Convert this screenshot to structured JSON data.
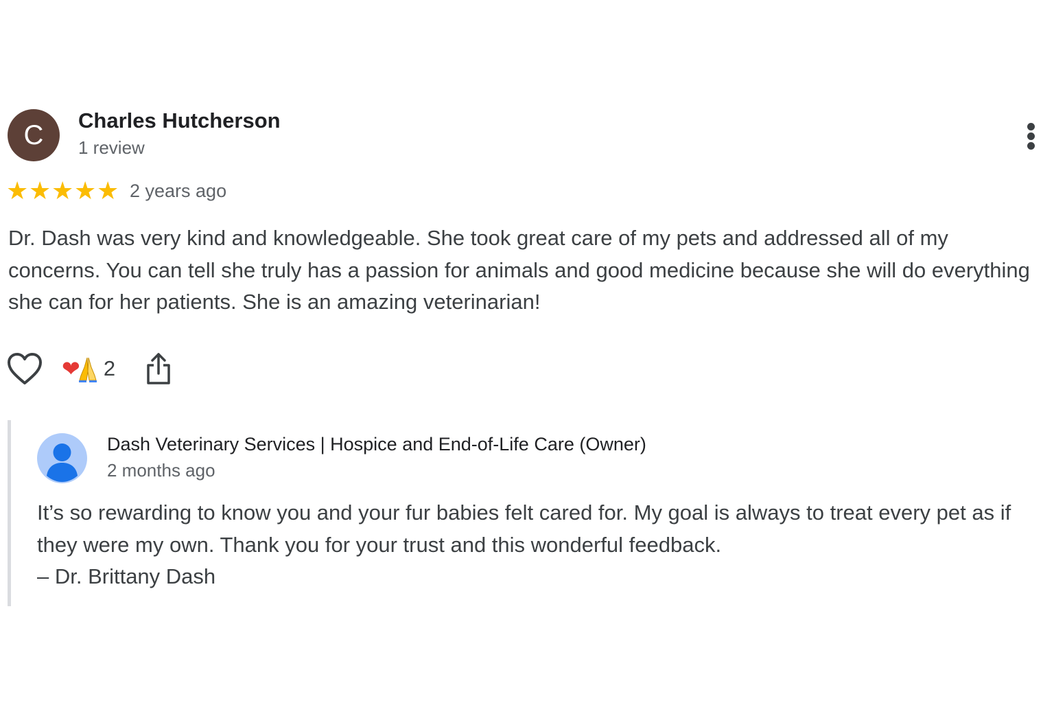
{
  "review": {
    "avatar_letter": "C",
    "avatar_color": "#5d4037",
    "reviewer_name": "Charles Hutcherson",
    "reviewer_review_count": "1 review",
    "rating": 5,
    "star_glyph": "★",
    "star_color": "#fbbc04",
    "time": "2 years ago",
    "text": "Dr. Dash was very kind and knowledgeable. She took great care of my pets and addressed all of my concerns. You can tell she truly has a passion for animals and good medicine because she will do everything she can for her patients. She is an amazing veterinarian!",
    "more_icon": "more-vert-icon"
  },
  "actions": {
    "like_icon": "heart-outline-icon",
    "reaction_icons": [
      "red-heart-emoji",
      "folded-hands-emoji"
    ],
    "reaction_heart_glyph": "❤",
    "reaction_count": "2",
    "share_icon": "share-icon"
  },
  "owner_response": {
    "owner_name": "Dash Veterinary Services | Hospice and End-of-Life Care (Owner)",
    "time": "2 months ago",
    "avatar_icon": "default-person-avatar-icon",
    "avatar_color": "#aecbfa",
    "text_lines": [
      "It’s so rewarding to know you and your fur babies felt cared for. My goal is always to treat every pet as if they were my own. Thank you for your trust and this wonderful feedback.",
      "– Dr. Brittany Dash"
    ]
  }
}
